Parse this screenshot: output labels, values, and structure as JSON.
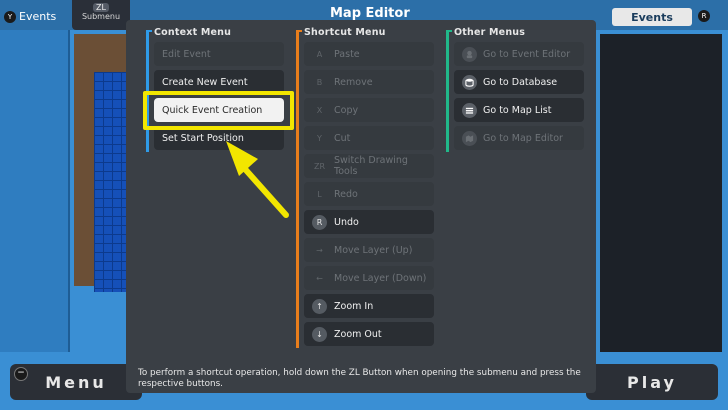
{
  "background": {
    "left_tab": "Events",
    "left_tab_key": "Y",
    "submenu_key": "ZL",
    "submenu_label": "Submenu",
    "title": "Map Editor",
    "right_tab": "Events",
    "right_tab_key": "R",
    "menu_button": "Menu",
    "menu_key": "−",
    "play_button": "Play"
  },
  "popup": {
    "context_menu": {
      "header": "Context Menu",
      "items": [
        {
          "label": "Edit Event"
        },
        {
          "label": "Create New Event"
        },
        {
          "label": "Quick Event Creation"
        },
        {
          "label": "Set Start Position"
        }
      ]
    },
    "shortcut_menu": {
      "header": "Shortcut Menu",
      "items": [
        {
          "key": "A",
          "label": "Paste"
        },
        {
          "key": "B",
          "label": "Remove"
        },
        {
          "key": "X",
          "label": "Copy"
        },
        {
          "key": "Y",
          "label": "Cut"
        },
        {
          "key": "ZR",
          "label": "Switch Drawing Tools"
        },
        {
          "key": "L",
          "label": "Redo"
        },
        {
          "key": "R",
          "label": "Undo"
        },
        {
          "key": "→",
          "label": "Move Layer (Up)"
        },
        {
          "key": "←",
          "label": "Move Layer (Down)"
        },
        {
          "key": "↑",
          "label": "Zoom In"
        },
        {
          "key": "↓",
          "label": "Zoom Out"
        }
      ]
    },
    "other_menus": {
      "header": "Other Menus",
      "items": [
        {
          "label": "Go to Event Editor"
        },
        {
          "label": "Go to Database"
        },
        {
          "label": "Go to Map List"
        },
        {
          "label": "Go to Map Editor"
        }
      ]
    },
    "footer": "To perform a shortcut operation, hold down the ZL Button when opening the submenu and press the respective buttons."
  },
  "colors": {
    "context_accent": "#2f9be8",
    "shortcut_accent": "#e87e1c",
    "other_accent": "#21b88a",
    "highlight": "#f2e600"
  }
}
